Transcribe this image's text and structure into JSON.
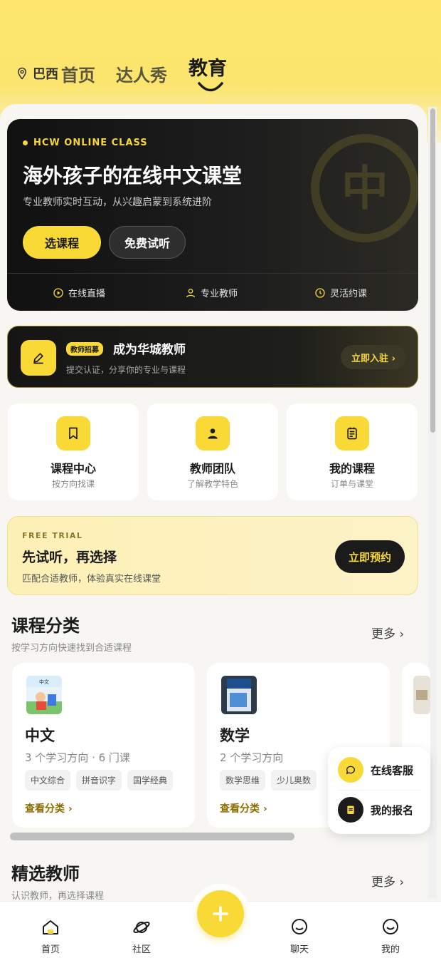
{
  "colors": {
    "accent": "#f8d935",
    "dark": "#1b1b1b",
    "link": "#8a6d00"
  },
  "header": {
    "location": "巴西",
    "tabs": [
      "首页",
      "达人秀",
      "教育"
    ],
    "active_tab": "教育"
  },
  "hero": {
    "kicker": "HCW ONLINE CLASS",
    "title": "海外孩子的在线中文课堂",
    "subtitle": "专业教师实时互动，从兴趣启蒙到系统进阶",
    "primary_button": "选课程",
    "secondary_button": "免费试听",
    "emblem_char": "中",
    "features": [
      {
        "icon": "play-circle-icon",
        "label": "在线直播"
      },
      {
        "icon": "person-icon",
        "label": "专业教师"
      },
      {
        "icon": "clock-icon",
        "label": "灵活约课"
      }
    ]
  },
  "recruit": {
    "badge": "教师招募",
    "title": "成为华城教师",
    "subtitle": "提交认证，分享你的专业与课程",
    "button": "立即入驻 ›"
  },
  "shortcuts": [
    {
      "icon": "bookmark-icon",
      "title": "课程中心",
      "subtitle": "按方向找课"
    },
    {
      "icon": "person-icon",
      "title": "教师团队",
      "subtitle": "了解教学特色"
    },
    {
      "icon": "list-icon",
      "title": "我的课程",
      "subtitle": "订单与课堂"
    }
  ],
  "trial": {
    "kicker": "FREE TRIAL",
    "title": "先试听，再选择",
    "subtitle": "匹配合适教师，体验真实在线课堂",
    "button": "立即预约"
  },
  "categories_section": {
    "title": "课程分类",
    "subtitle": "按学习方向快速找到合适课程",
    "more": "更多 ›"
  },
  "categories": [
    {
      "title": "中文",
      "meta": "3 个学习方向 · 6 门课",
      "tags": [
        "中文综合",
        "拼音识字",
        "国学经典"
      ],
      "link": "查看分类 ›"
    },
    {
      "title": "数学",
      "meta": "2 个学习方向",
      "tags": [
        "数学思维",
        "少儿奥数"
      ],
      "link": "查看分类 ›"
    }
  ],
  "teachers_section": {
    "title": "精选教师",
    "subtitle": "认识教师，再选择课程",
    "more": "更多 ›"
  },
  "float_menu": {
    "service": "在线客服",
    "signup": "我的报名"
  },
  "bottom_nav": {
    "home": "首页",
    "community": "社区",
    "chat": "聊天",
    "me": "我的"
  }
}
